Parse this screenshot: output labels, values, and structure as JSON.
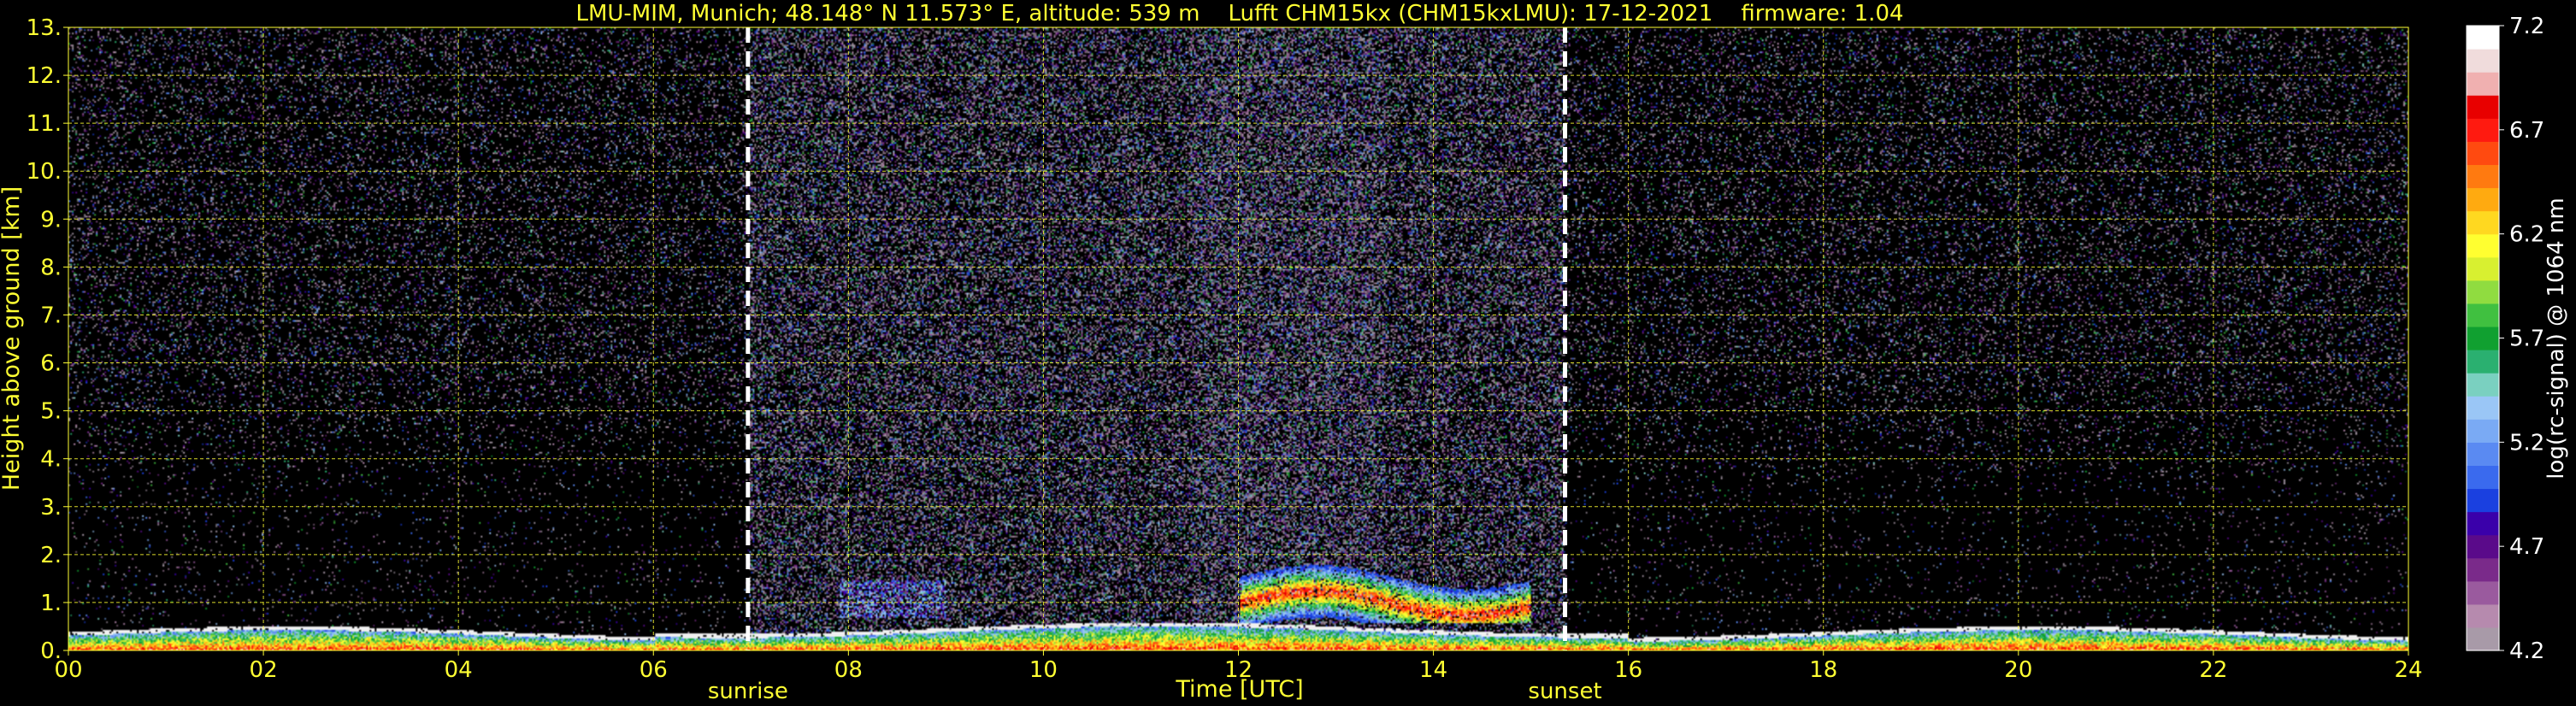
{
  "chart_data": {
    "type": "heatmap",
    "title": "LMU-MIM, Munich; 48.148° N 11.573° E, altitude: 539 m    Lufft CHM15kx (CHM15kxLMU): 17-12-2021    firmware: 1.04",
    "xlabel": "Time [UTC]",
    "ylabel": "Height above ground [km]",
    "xlim": [
      0,
      24
    ],
    "ylim": [
      0,
      13
    ],
    "x_ticks": [
      "00",
      "02",
      "04",
      "06",
      "08",
      "10",
      "12",
      "14",
      "16",
      "18",
      "20",
      "22",
      "24"
    ],
    "y_ticks": [
      "0.",
      "1.",
      "2.",
      "3.",
      "4.",
      "5.",
      "6.",
      "7.",
      "8.",
      "9.",
      "10.",
      "11.",
      "12.",
      "13."
    ],
    "grid": true,
    "grid_color": "#ffff33",
    "annotations": [
      {
        "text": "sunrise",
        "x": 6.97
      },
      {
        "text": "sunset",
        "x": 15.35
      }
    ],
    "colorbar": {
      "label": "log(rc-signal) @ 1064 nm",
      "range": [
        4.2,
        7.2
      ],
      "ticks": [
        "7.2",
        "6.7",
        "6.2",
        "5.7",
        "5.2",
        "4.7",
        "4.2"
      ],
      "colors_low_to_high": [
        "#a89aa8",
        "#b68aae",
        "#9a5a9e",
        "#7a2a8a",
        "#5a0a8a",
        "#3a00aa",
        "#1a40e0",
        "#3a6aee",
        "#5a8af2",
        "#7aaaf4",
        "#9ac6f6",
        "#7ad0c0",
        "#2ab070",
        "#10a030",
        "#40c040",
        "#90dc40",
        "#d8f030",
        "#ffff30",
        "#ffd820",
        "#ffaa10",
        "#ff7a10",
        "#ff4a10",
        "#ff1a10",
        "#e80000",
        "#f0b0b0",
        "#f0dcdc",
        "#ffffff"
      ]
    },
    "features": [
      {
        "name": "boundary layer",
        "x": [
          0,
          24
        ],
        "y": [
          0,
          0.5
        ],
        "level": "high"
      },
      {
        "name": "cloud layer",
        "x": [
          8,
          9
        ],
        "y": [
          0.7,
          1.4
        ],
        "level": "mid"
      },
      {
        "name": "cloud layer",
        "x": [
          12,
          15
        ],
        "y": [
          0.6,
          1.8
        ],
        "level": "high"
      }
    ]
  }
}
